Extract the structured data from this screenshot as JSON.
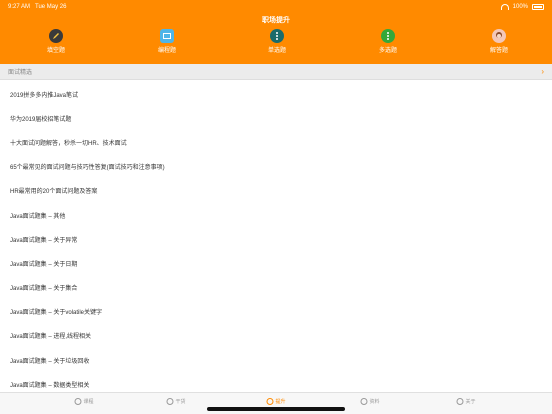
{
  "status": {
    "time": "9:27 AM",
    "date": "Tue May 26",
    "battery": "100%"
  },
  "header": {
    "title": "职场提升"
  },
  "categories": [
    {
      "label": "填空题",
      "icon": "pencil-icon"
    },
    {
      "label": "编程题",
      "icon": "screen-icon"
    },
    {
      "label": "单选题",
      "icon": "single-choice-icon"
    },
    {
      "label": "多选题",
      "icon": "multi-choice-icon"
    },
    {
      "label": "解答题",
      "icon": "avatar-icon"
    }
  ],
  "search": {
    "label": "面试精选"
  },
  "list": [
    "2019拼多多内推Java笔试",
    "华为2019届校招笔试题",
    "十大面试问题解答，秒杀一切HR、技术面试",
    "65个最常见的面试问题与技巧性答复(面试技巧和注意事项)",
    "HR最常用的20个面试问题及答案",
    "Java面试题集 – 其他",
    "Java面试题集 – 关于异常",
    "Java面试题集 – 关于日期",
    "Java面试题集 – 关于集合",
    "Java面试题集 – 关于volatile关键字",
    "Java面试题集 – 进程,线程相关",
    "Java面试题集 – 关于垃圾回收",
    "Java面试题集 – 数据类型相关"
  ],
  "tabs": [
    {
      "label": "课程"
    },
    {
      "label": "干货"
    },
    {
      "label": "提升"
    },
    {
      "label": "资料"
    },
    {
      "label": "关于"
    }
  ],
  "colors": {
    "accent": "#ff8a00"
  }
}
